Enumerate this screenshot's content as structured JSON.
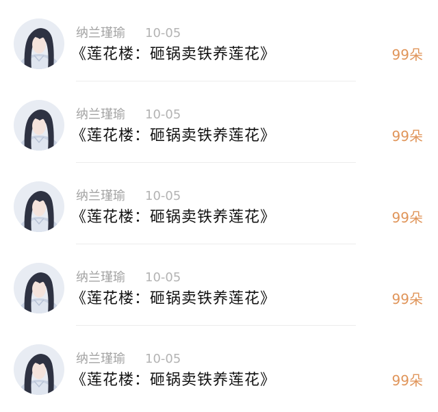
{
  "colors": {
    "username": "#a3a3a3",
    "date": "#b3b3b3",
    "count": "#e0955a",
    "divider": "#ececec"
  },
  "rows": [
    {
      "avatar_icon": "character-avatar",
      "username": "纳兰瑾瑜",
      "date": "10-05",
      "title": "《莲花楼：砸锅卖铁养莲花》",
      "count": "99朵"
    },
    {
      "avatar_icon": "character-avatar",
      "username": "纳兰瑾瑜",
      "date": "10-05",
      "title": "《莲花楼：砸锅卖铁养莲花》",
      "count": "99朵"
    },
    {
      "avatar_icon": "character-avatar",
      "username": "纳兰瑾瑜",
      "date": "10-05",
      "title": "《莲花楼：砸锅卖铁养莲花》",
      "count": "99朵"
    },
    {
      "avatar_icon": "character-avatar",
      "username": "纳兰瑾瑜",
      "date": "10-05",
      "title": "《莲花楼：砸锅卖铁养莲花》",
      "count": "99朵"
    },
    {
      "avatar_icon": "character-avatar",
      "username": "纳兰瑾瑜",
      "date": "10-05",
      "title": "《莲花楼：砸锅卖铁养莲花》",
      "count": "99朵"
    }
  ]
}
